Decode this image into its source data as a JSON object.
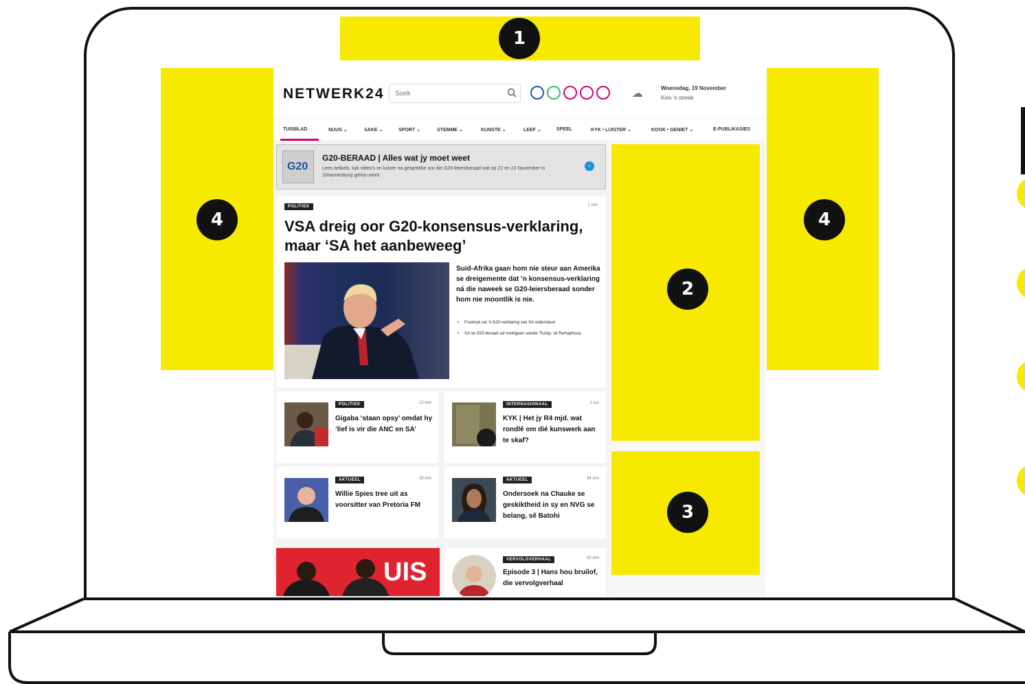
{
  "ad_markers": {
    "top": "1",
    "sidebar_large": "2",
    "sidebar_small": "3",
    "skin_left": "4",
    "skin_right": "4"
  },
  "site": {
    "logo": "NETWERK24",
    "search_placeholder": "Soek",
    "social_icons": [
      "facebook-icon",
      "whatsapp-icon",
      "instagram-icon",
      "tiktok-icon",
      "pinterest-icon"
    ],
    "weather_icon": "weather-icon",
    "date": "Woensdag, 19 November",
    "region": "Kies 'n streek"
  },
  "nav": {
    "items": [
      "TUISBLAD",
      "NUUS ⌄",
      "SAKE ⌄",
      "SPORT ⌄",
      "STEMME ⌄",
      "KUNSTE ⌄",
      "LEEF ⌄",
      "SPEEL",
      "KYK • LUISTER ⌄",
      "KOOK • GENIET ⌄",
      "E-PUBLIKASIES"
    ]
  },
  "banner": {
    "thumb_text": "G20",
    "title": "G20-BERAAD | Alles wat jy moet weet",
    "description": "Lees artikels, kyk video's en luister na gesprekke oor die G20-leiersberaad wat op 22 en 23 November in Johannesburg gehou word.",
    "arrow": "›"
  },
  "main_article": {
    "tag": "POLITIEK",
    "time": "1 min",
    "headline": "VSA dreig oor G20-konsensus-verklaring, maar ‘SA het aanbeweeg’",
    "summary": "Suid-Afrika gaan hom nie steur aan Amerika se dreigemente dat ’n konsensus-verklaring ná die naweek se G20-leiersberaad sonder hom nie moontlik is nie.",
    "bullets": [
      "Frankryk sal ’n G20-verklaring van SA ondersteun",
      "SA se G20-beraad sal voortgaan sonder Trump, sê Ramaphosa"
    ]
  },
  "cards": [
    {
      "tag": "POLITIEK",
      "time": "12 min",
      "title": "Gigaba ‘staan opsy’ omdat hy ‘lief is vir die ANC en SA’"
    },
    {
      "tag": "INTERNASIONAAL",
      "time": "1 uur",
      "title": "KYK | Het jy R4 mjd. wat rondlê om dié kunswerk aan te skaf?"
    },
    {
      "tag": "AKTUEEL",
      "time": "33 min",
      "title": "Willie Spies tree uit as voorsitter van Pretoria FM"
    },
    {
      "tag": "AKTUEEL",
      "time": "34 min",
      "title": "Ondersoek na Chauke se geskiktheid in sy en NVG se belang, sê Batohi"
    },
    {
      "tag": "VERVOLGVERHAAL",
      "time": "43 min",
      "title": "Episode 3 | Hans hou bruilof, die vervolgverhaal"
    }
  ],
  "promo": {
    "text": "UIS"
  },
  "colors": {
    "ad_yellow": "#f7ea00",
    "nav_accent": "#d6006b",
    "promo_red": "#e0242f"
  }
}
